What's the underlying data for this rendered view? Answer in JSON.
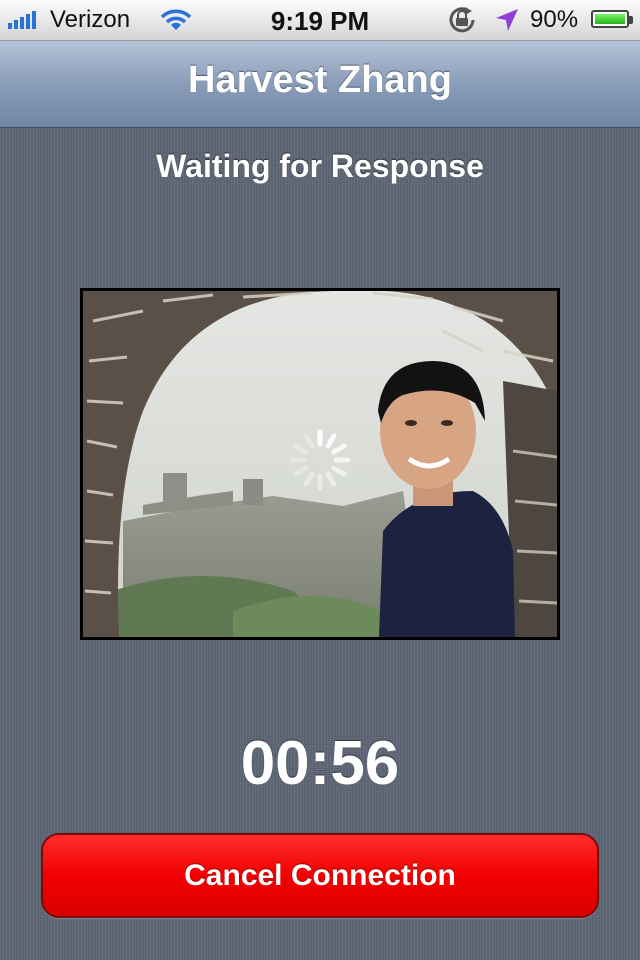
{
  "status_bar": {
    "carrier": "Verizon",
    "time": "9:19 PM",
    "battery_percent": "90%",
    "signal_bars": 5,
    "battery_level": 0.9,
    "icons": [
      "signal-icon",
      "wifi-icon",
      "rotation-lock-icon",
      "location-icon",
      "battery-icon"
    ]
  },
  "nav": {
    "title": "Harvest Zhang"
  },
  "call": {
    "status": "Waiting for Response",
    "timer": "00:56",
    "cancel_label": "Cancel Connection"
  },
  "colors": {
    "nav_blue": "#7f95b3",
    "background_linen": "#5f6676",
    "cancel_red": "#f20000",
    "signal_blue": "#2a72d8",
    "battery_green": "#27b51a"
  }
}
